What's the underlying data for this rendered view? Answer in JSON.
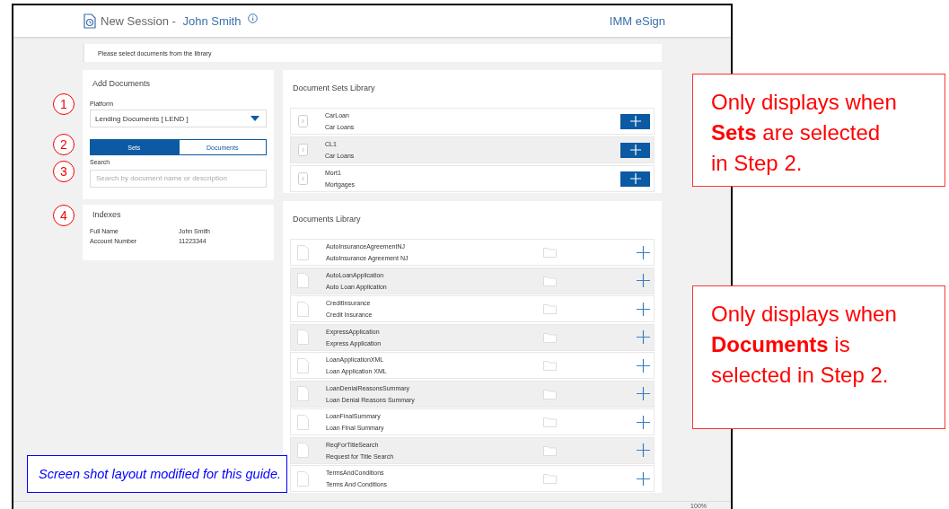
{
  "header": {
    "title": "New Session - ",
    "user": "John Smith",
    "app": "IMM eSign"
  },
  "info_bar": "Please select documents from the library",
  "add_documents": {
    "title": "Add Documents",
    "platform_label": "Platform",
    "platform_value": "Lending Documents [ LEND ]",
    "toggle": [
      {
        "label": "Sets",
        "selected": true
      },
      {
        "label": "Documents",
        "selected": false
      }
    ],
    "search_label": "Search",
    "search_placeholder": "Search by document name or description"
  },
  "indexes": {
    "title": "Indexes",
    "rows": [
      {
        "name": "Full Name",
        "value": "John Smith"
      },
      {
        "name": "Account Number",
        "value": "11223344"
      }
    ]
  },
  "document_sets": {
    "title": "Document Sets Library",
    "items": [
      {
        "name": "CarLoan",
        "description": "Car Loans"
      },
      {
        "name": "CL1",
        "description": "Car Loans"
      },
      {
        "name": "Mort1",
        "description": "Mortgages"
      }
    ]
  },
  "documents": {
    "title": "Documents Library",
    "items": [
      {
        "name": "AutoInsuranceAgreementNJ",
        "description": "AutoInsurance Agreement NJ"
      },
      {
        "name": "AutoLoanApplication",
        "description": "Auto Loan Application"
      },
      {
        "name": "CreditInsurance",
        "description": "Credit Insurance"
      },
      {
        "name": "ExpressApplication",
        "description": "Express Application"
      },
      {
        "name": "LoanApplicationXML",
        "description": "Loan Application XML"
      },
      {
        "name": "LoanDenialReasonsSummary",
        "description": "Loan Denial Reasons Summary"
      },
      {
        "name": "LoanFinalSummary",
        "description": "Loan Final Summary"
      },
      {
        "name": "ReqForTitleSearch",
        "description": "Request for Title Search"
      },
      {
        "name": "TermsAndConditions",
        "description": "Terms And Conditions"
      }
    ]
  },
  "status_bar": {
    "zoom": "100%"
  },
  "annotations": {
    "steps": [
      "1",
      "2",
      "3",
      "4"
    ],
    "notes": [
      "Only displays when **Sets** are selected in Step 2.",
      "Only displays when **Documents** is selected in Step 2."
    ],
    "guide_note": "Screen shot layout modified for this guide."
  }
}
